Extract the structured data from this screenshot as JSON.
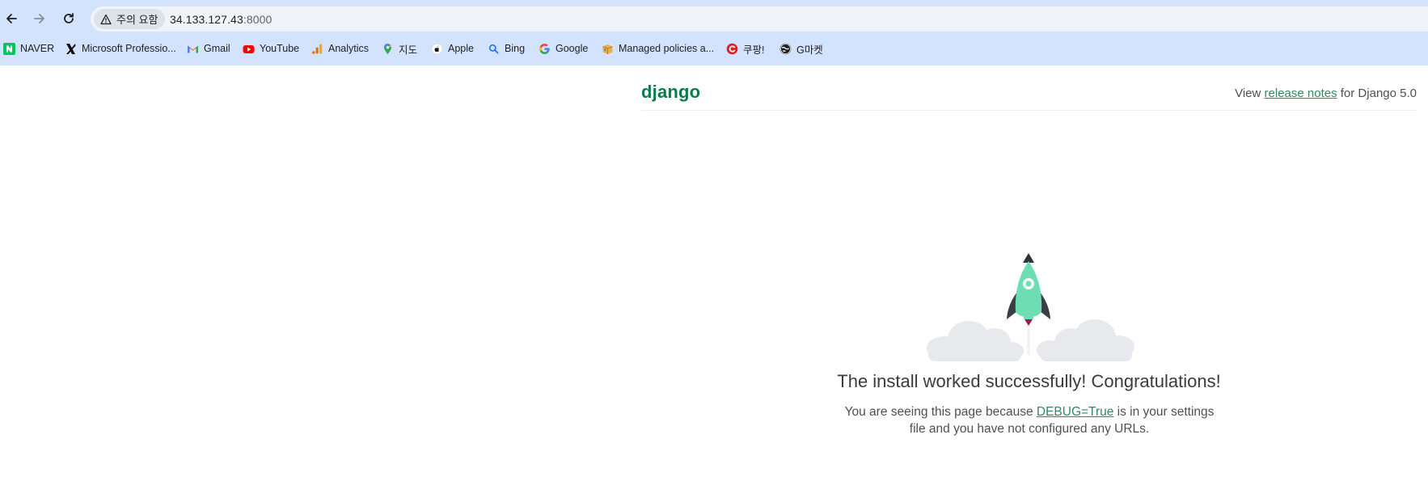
{
  "browser": {
    "security_chip": "주의 요함",
    "url_host": "34.133.127.43",
    "url_port": ":8000",
    "bookmarks": [
      {
        "label": "NAVER",
        "icon": "naver-icon"
      },
      {
        "label": "Microsoft Professio...",
        "icon": "microsoft-x-icon"
      },
      {
        "label": "Gmail",
        "icon": "gmail-icon"
      },
      {
        "label": "YouTube",
        "icon": "youtube-icon"
      },
      {
        "label": "Analytics",
        "icon": "analytics-icon"
      },
      {
        "label": "지도",
        "icon": "maps-icon"
      },
      {
        "label": "Apple",
        "icon": "apple-icon"
      },
      {
        "label": "Bing",
        "icon": "bing-icon"
      },
      {
        "label": "Google",
        "icon": "google-icon"
      },
      {
        "label": "Managed policies a...",
        "icon": "package-icon"
      },
      {
        "label": "쿠팡!",
        "icon": "coupang-icon"
      },
      {
        "label": "G마켓",
        "icon": "gmarket-icon"
      }
    ]
  },
  "django": {
    "logo": "django",
    "release_prefix": "View ",
    "release_link": "release notes",
    "release_suffix": " for Django 5.0",
    "headline": "The install worked successfully! Congratulations!",
    "sub_prefix": "You are seeing this page because ",
    "sub_link": "DEBUG=True",
    "sub_suffix": " is in your settings file and you have not configured any URLs."
  },
  "colors": {
    "chrome": "#d3e3fd",
    "django_green": "#0c7a4a",
    "link_green": "#2a8c5f",
    "rocket_body": "#6dddb4"
  }
}
